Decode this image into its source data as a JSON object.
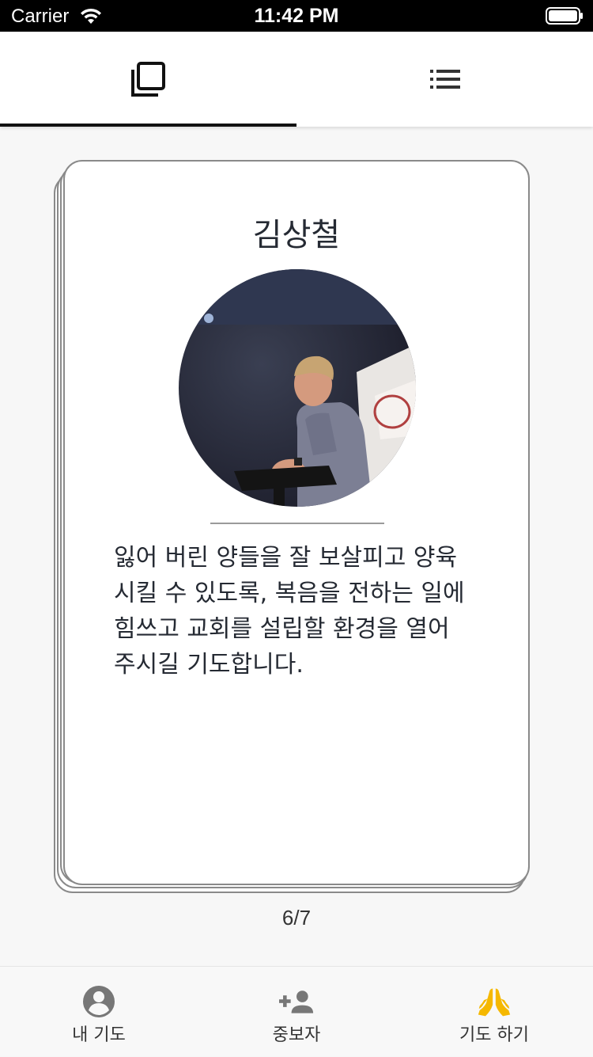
{
  "status_bar": {
    "carrier": "Carrier",
    "time": "11:42 PM"
  },
  "tabs": [
    {
      "id": "card-view",
      "icon": "card-stack-icon",
      "selected": true
    },
    {
      "id": "list-view",
      "icon": "list-icon",
      "selected": false
    }
  ],
  "card": {
    "name": "김상철",
    "photo": "person-at-podium-photo",
    "prayer_text": "잃어 버린 양들을 잘 보살피고 양육 시킬 수 있도록, 복음을 전하는 일에 힘쓰고 교회를 설립할 환경을 열어 주시길 기도합니다."
  },
  "pagination": {
    "text": "6/7"
  },
  "bottom_nav": {
    "items": [
      {
        "label": "내 기도",
        "icon": "account-circle-icon",
        "active": false
      },
      {
        "label": "중보자",
        "icon": "person-add-icon",
        "active": false
      },
      {
        "label": "기도 하기",
        "icon": "praying-hands-icon",
        "active": true
      }
    ]
  },
  "colors": {
    "active_nav": "#f5b800",
    "inactive_icon": "#777777",
    "card_border": "#8a8a8a",
    "tab_indicator": "#111111"
  }
}
